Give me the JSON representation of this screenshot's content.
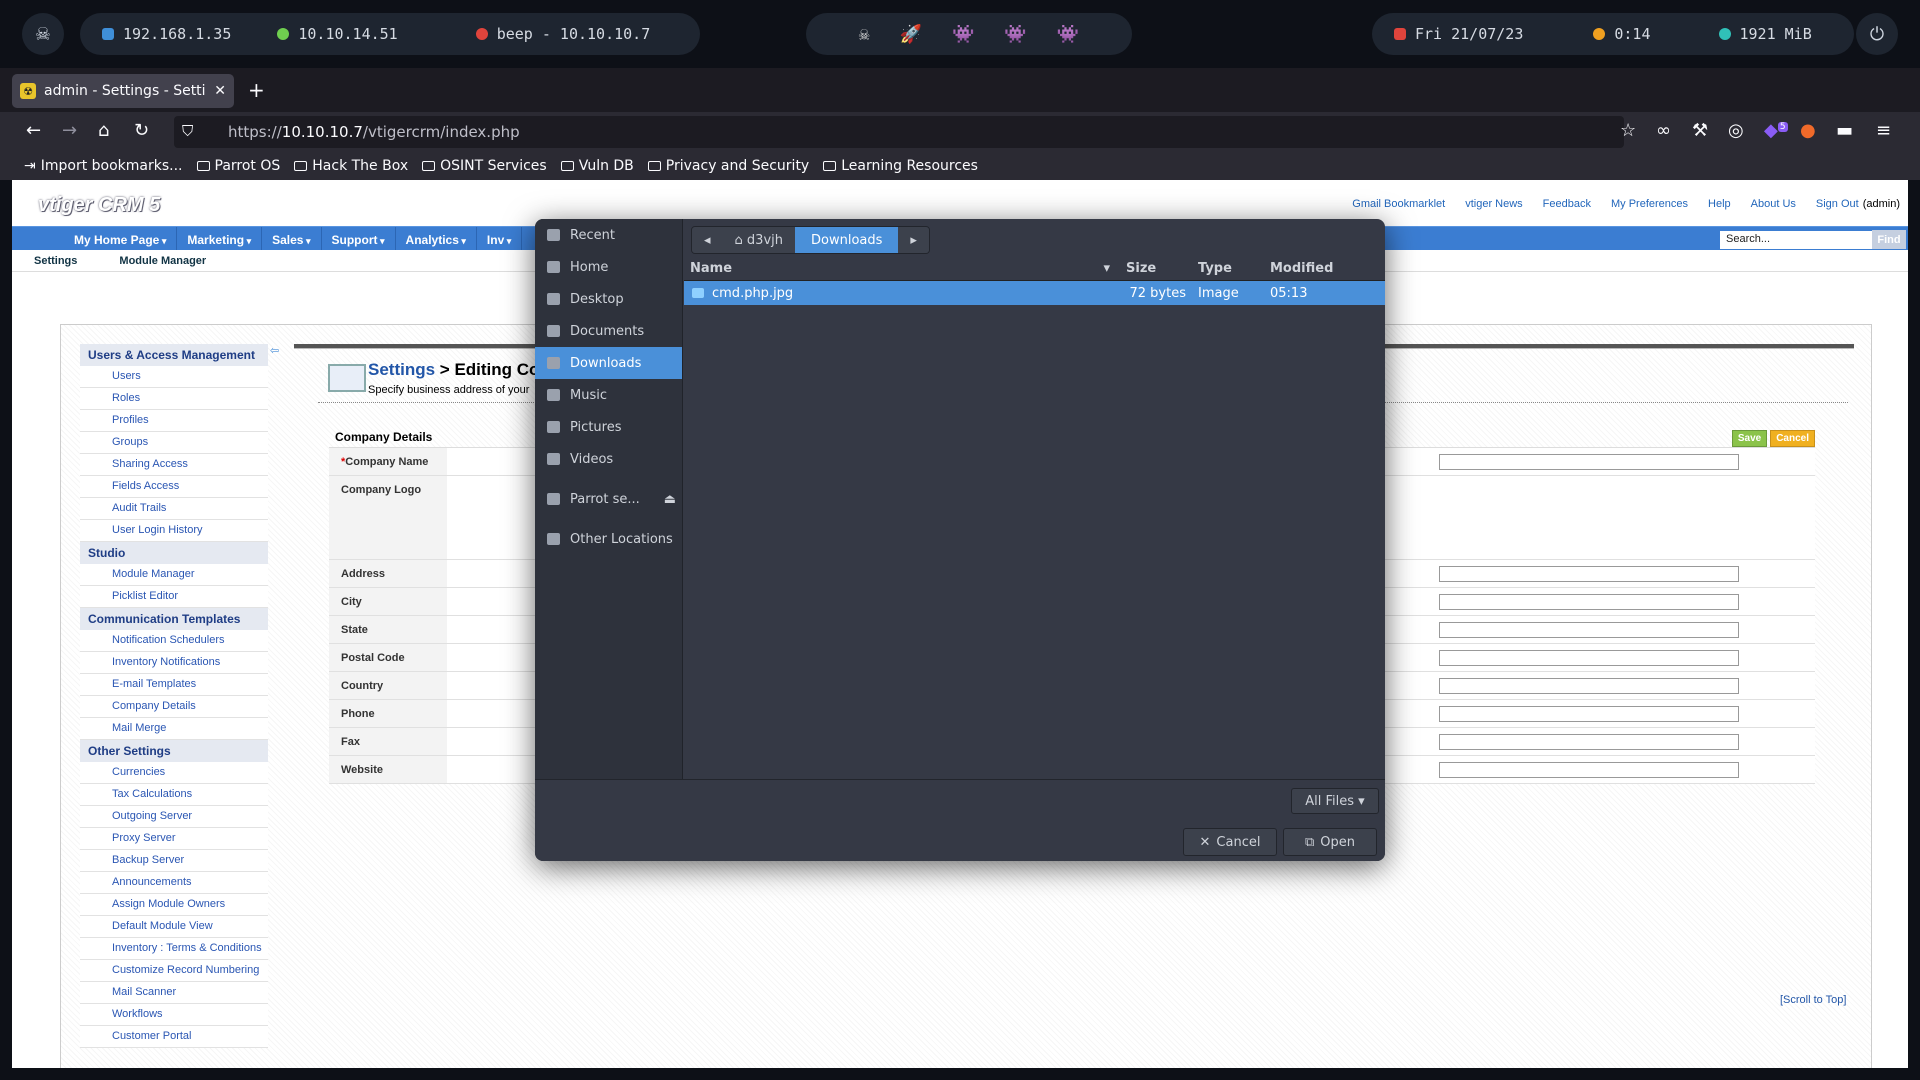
{
  "topbar": {
    "ip1": "192.168.1.35",
    "ip2": "10.10.14.51",
    "target": "beep - 10.10.10.7",
    "date": "Fri 21/07/23",
    "timer": "0:14",
    "mem": "1921 MiB"
  },
  "browser": {
    "tab_title": "admin - Settings - Setting",
    "url_prefix": "https://",
    "url_host": "10.10.10.7",
    "url_path": "/vtigercrm/index.php",
    "ext_badge": "5",
    "bookmarks": [
      "Import bookmarks...",
      "Parrot OS",
      "Hack The Box",
      "OSINT Services",
      "Vuln DB",
      "Privacy and Security",
      "Learning Resources"
    ]
  },
  "crm": {
    "logo": "vtiger CRM 5",
    "toplinks": [
      "Gmail Bookmarklet",
      "vtiger News",
      "Feedback",
      "My Preferences",
      "Help",
      "About Us",
      "Sign Out"
    ],
    "user": "(admin)",
    "menu": [
      "My Home Page",
      "Marketing",
      "Sales",
      "Support",
      "Analytics",
      "Inv"
    ],
    "search": "Search...",
    "find": "Find",
    "sub": [
      "Settings",
      "Module Manager"
    ],
    "sections": [
      {
        "title": "Users & Access Management",
        "items": [
          "Users",
          "Roles",
          "Profiles",
          "Groups",
          "Sharing Access",
          "Fields Access",
          "Audit Trails",
          "User Login History"
        ]
      },
      {
        "title": "Studio",
        "items": [
          "Module Manager",
          "Picklist Editor"
        ]
      },
      {
        "title": "Communication Templates",
        "items": [
          "Notification Schedulers",
          "Inventory Notifications",
          "E-mail Templates",
          "Company Details",
          "Mail Merge"
        ]
      },
      {
        "title": "Other Settings",
        "items": [
          "Currencies",
          "Tax Calculations",
          "Outgoing Server",
          "Proxy Server",
          "Backup Server",
          "Announcements",
          "Assign Module Owners",
          "Default Module View",
          "Inventory : Terms & Conditions",
          "Customize Record Numbering",
          "Mail Scanner",
          "Workflows",
          "Customer Portal"
        ]
      }
    ],
    "title_link": "Settings",
    "title_rest": "> Editing Co",
    "desc": "Specify business address of your",
    "cd_header": "Company Details",
    "save": "Save",
    "cancel": "Cancel",
    "fields": [
      "Company Name",
      "Company Logo",
      "Address",
      "City",
      "State",
      "Postal Code",
      "Country",
      "Phone",
      "Fax",
      "Website"
    ],
    "scroll_top": "[Scroll to Top]"
  },
  "dialog": {
    "places": [
      "Recent",
      "Home",
      "Desktop",
      "Documents",
      "Downloads",
      "Music",
      "Pictures",
      "Videos",
      "Parrot se...",
      "Other Locations"
    ],
    "path": [
      "d3vjh",
      "Downloads"
    ],
    "cols": [
      "Name",
      "Size",
      "Type",
      "Modified"
    ],
    "file": {
      "name": "cmd.php.jpg",
      "size": "72 bytes",
      "type": "Image",
      "modified": "05:13"
    },
    "filter": "All Files",
    "cancel": "Cancel",
    "open": "Open"
  }
}
